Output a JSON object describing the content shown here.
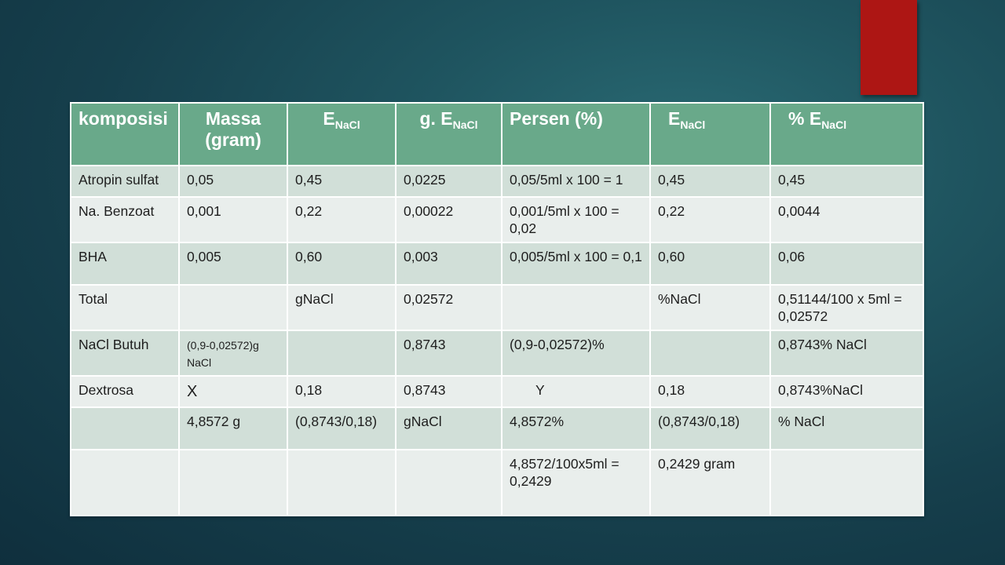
{
  "colors": {
    "header_bg": "#69a98a",
    "row_band": "#d1dfd8",
    "row_plain": "#e9eeec",
    "accent": "#ad1614"
  },
  "table": {
    "headers": [
      {
        "main": "komposisi",
        "sub": ""
      },
      {
        "main": "Massa (gram)",
        "sub": ""
      },
      {
        "main": "E",
        "sub": "NaCl"
      },
      {
        "main": "g. E",
        "sub": "NaCl"
      },
      {
        "main": "Persen  (%)",
        "sub": ""
      },
      {
        "main": "E",
        "sub": "NaCl"
      },
      {
        "main": "% E",
        "sub": "NaCl"
      }
    ],
    "rows": [
      [
        "Atropin sulfat",
        "0,05",
        "0,45",
        "0,0225",
        "0,05/5ml x 100 = 1",
        "0,45",
        "0,45"
      ],
      [
        "Na. Benzoat",
        "0,001",
        "0,22",
        "0,00022",
        "0,001/5ml x 100 = 0,02",
        "0,22",
        "0,0044"
      ],
      [
        "BHA",
        "0,005",
        "0,60",
        "0,003",
        "0,005/5ml x 100 = 0,1",
        "0,60",
        "0,06"
      ],
      [
        "Total",
        "",
        "gNaCl",
        "0,02572",
        "",
        "%NaCl",
        "0,51144/100 x 5ml = 0,02572"
      ],
      [
        "NaCl Butuh",
        "(0,9-0,02572)g NaCl",
        "",
        "0,8743",
        "(0,9-0,02572)%",
        "",
        "0,8743% NaCl"
      ],
      [
        "Dextrosa",
        "X",
        "0,18",
        "0,8743",
        "Y",
        "0,18",
        "0,8743%NaCl"
      ],
      [
        "",
        "4,8572 g",
        "(0,8743/0,18)",
        "gNaCl",
        "4,8572%",
        "(0,8743/0,18)",
        "% NaCl"
      ],
      [
        "",
        "",
        "",
        "",
        "4,8572/100x5ml = 0,2429",
        "0,2429 gram",
        ""
      ]
    ]
  }
}
